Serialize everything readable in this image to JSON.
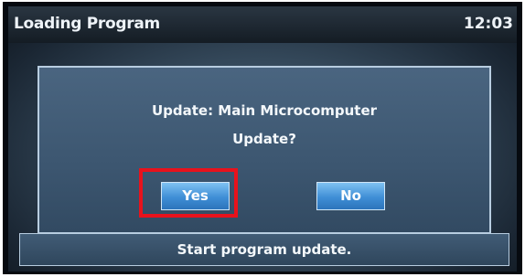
{
  "header": {
    "title": "Loading Program",
    "clock": "12:03"
  },
  "dialog": {
    "message_line1": "Update: Main Microcomputer",
    "message_line2": "Update?",
    "yes_label": "Yes",
    "no_label": "No"
  },
  "status": {
    "text": "Start program update."
  },
  "colors": {
    "highlight_box": "#e8121c",
    "button_blue": "#3f8ed6",
    "dialog_border": "#b8cde0"
  }
}
